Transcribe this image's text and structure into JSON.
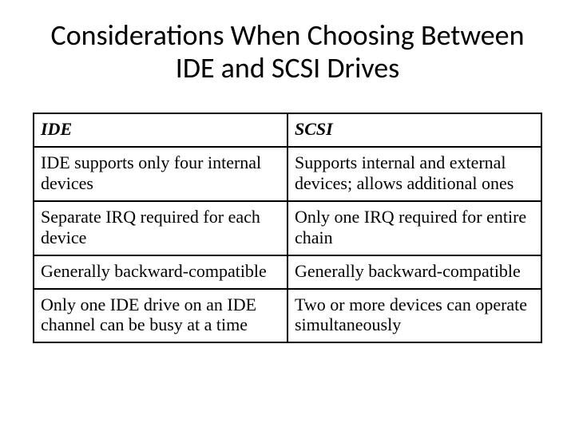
{
  "title": "Considerations When Choosing Between IDE and SCSI Drives",
  "table": {
    "headers": {
      "col1": "IDE",
      "col2": "SCSI"
    },
    "rows": [
      {
        "ide": "IDE supports only four internal devices",
        "scsi": "Supports internal and external devices; allows additional ones"
      },
      {
        "ide": "Separate IRQ required for each device",
        "scsi": "Only one IRQ required for entire chain"
      },
      {
        "ide": "Generally backward-compatible",
        "scsi": "Generally backward-compatible"
      },
      {
        "ide": "Only one IDE drive on an IDE channel can be busy at a time",
        "scsi": "Two or more devices can operate simultaneously"
      }
    ]
  },
  "chart_data": {
    "type": "table",
    "title": "Considerations When Choosing Between IDE and SCSI Drives",
    "columns": [
      "IDE",
      "SCSI"
    ],
    "rows": [
      [
        "IDE supports only four internal devices",
        "Supports internal and external devices; allows additional ones"
      ],
      [
        "Separate IRQ required for each device",
        "Only one IRQ required for entire chain"
      ],
      [
        "Generally backward-compatible",
        "Generally backward-compatible"
      ],
      [
        "Only one IDE drive on an IDE channel can be busy at a time",
        "Two or more devices can operate simultaneously"
      ]
    ]
  }
}
